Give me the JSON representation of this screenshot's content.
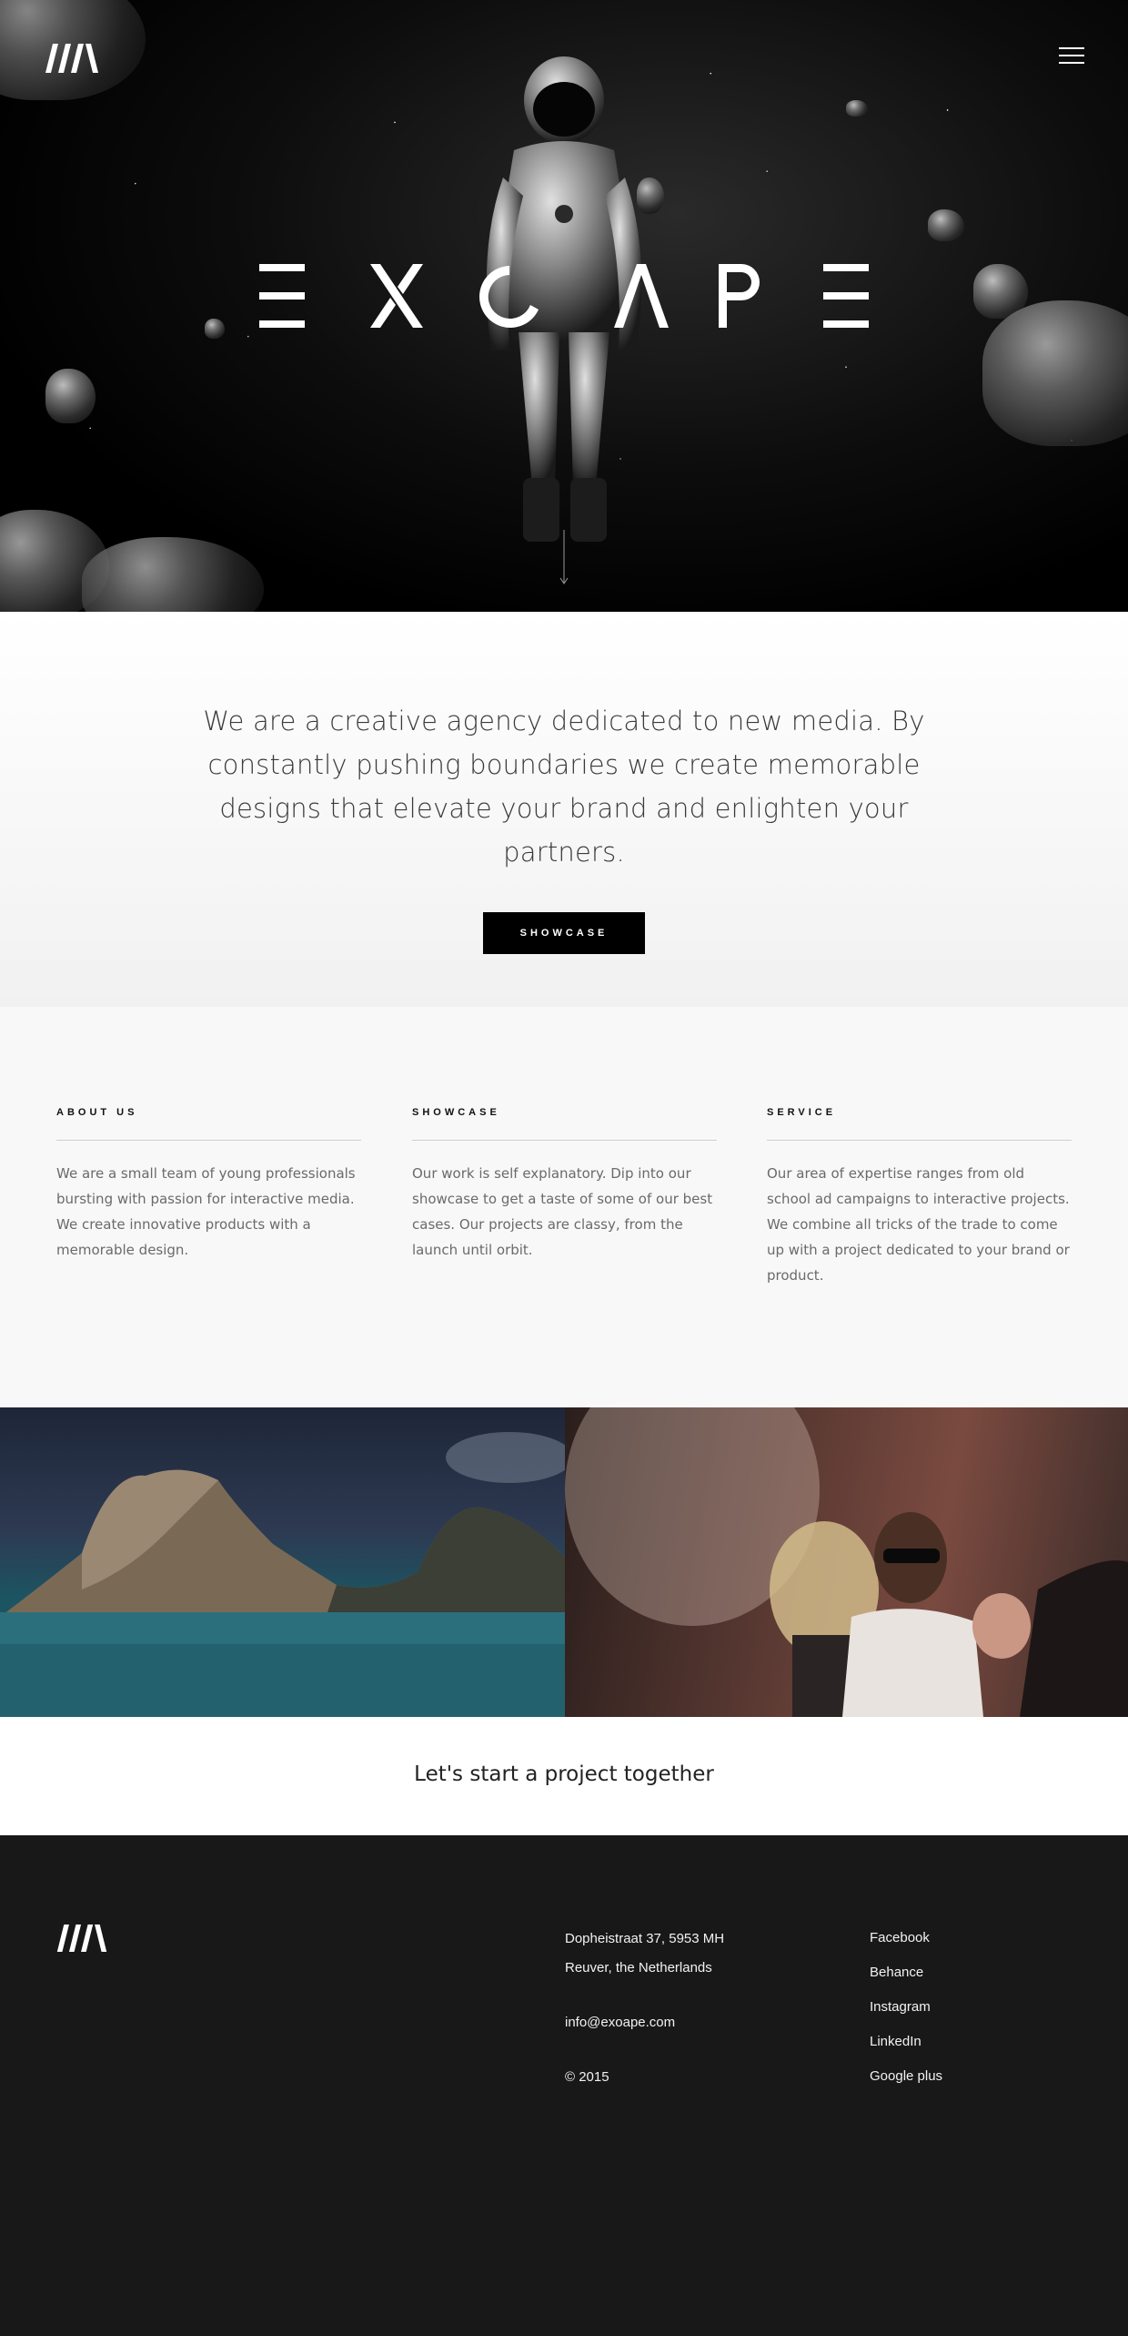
{
  "header": {
    "logo_icon": "exoape-logo-mark",
    "menu_icon": "hamburger-menu-icon",
    "hero_title": "EXOAPE",
    "scroll_icon": "scroll-down-arrow-icon"
  },
  "intro": {
    "text": "We are a creative agency dedicated to new media. By constantly pushing boundaries we create memorable designs that elevate your brand and enlighten your partners.",
    "button_label": "SHOWCASE"
  },
  "columns": [
    {
      "title": "ABOUT US",
      "text": "We are a small team of young professionals bursting with passion for interactive media. We create innovative products with a memorable design."
    },
    {
      "title": "SHOWCASE",
      "text": "Our work is self explanatory. Dip into our showcase to get a taste of some of our best cases. Our projects are classy, from the launch until orbit."
    },
    {
      "title": "SERVICE",
      "text": "Our area of expertise ranges from old school ad campaigns to interactive projects. We combine all tricks of the trade to come up with a project dedicated to your brand or product."
    }
  ],
  "cta": {
    "label": "Let's start a project together"
  },
  "footer": {
    "address_line1": "Dopheistraat 37, 5953 MH",
    "address_line2": "Reuver, the Netherlands",
    "email": "info@exoape.com",
    "copyright": "© 2015",
    "social": [
      "Facebook",
      "Behance",
      "Instagram",
      "LinkedIn",
      "Google plus"
    ]
  },
  "colors": {
    "background_dark": "#181818",
    "button": "#000000",
    "accent_text": "#ffffff"
  }
}
